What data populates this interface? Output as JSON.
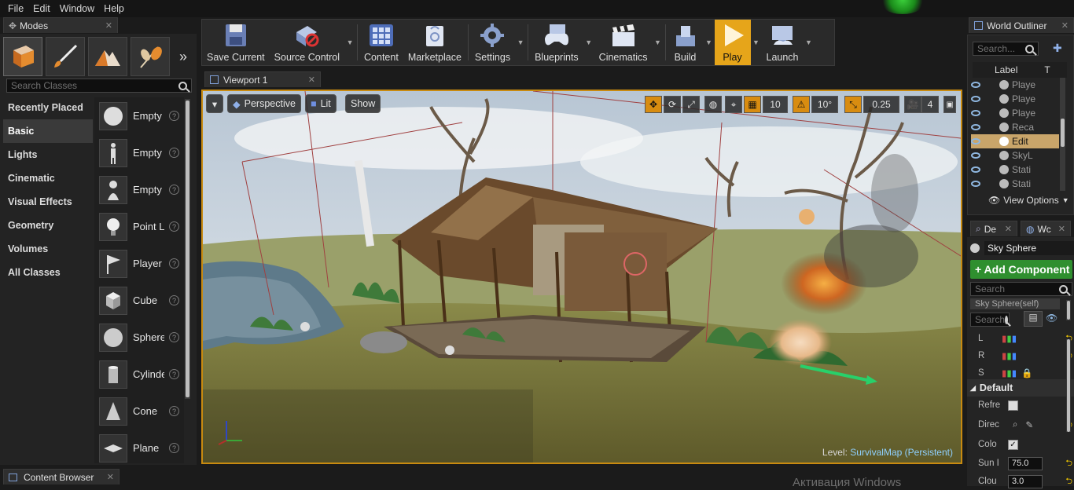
{
  "menubar": {
    "items": [
      "File",
      "Edit",
      "Window",
      "Help"
    ]
  },
  "modes": {
    "tab_label": "Modes",
    "search_placeholder": "Search Classes",
    "categories": [
      "Recently Placed",
      "Basic",
      "Lights",
      "Cinematic",
      "Visual Effects",
      "Geometry",
      "Volumes",
      "All Classes"
    ],
    "active_category": "Basic",
    "items": [
      "Empty",
      "Empty",
      "Empty",
      "Point L",
      "Player",
      "Cube",
      "Sphere",
      "Cylinde",
      "Cone",
      "Plane"
    ]
  },
  "toolbar": {
    "buttons": [
      "Save Current",
      "Source Control",
      "Content",
      "Marketplace",
      "Settings",
      "Blueprints",
      "Cinematics",
      "Build",
      "Play",
      "Launch"
    ]
  },
  "viewport": {
    "tab_label": "Viewport 1",
    "perspective": "Perspective",
    "lit": "Lit",
    "show": "Show",
    "grid_snap": "10",
    "rot_snap": "10°",
    "scale_snap": "0.25",
    "cam_speed": "4",
    "level_prefix": "Level:",
    "level_name": "SurvivalMap (Persistent)"
  },
  "outliner": {
    "tab_label": "World Outliner",
    "search_placeholder": "Search...",
    "col_label": "Label",
    "col_type": "T",
    "rows": [
      "Playe",
      "Playe",
      "Playe",
      "Reca",
      "Edit",
      "SkyL",
      "Stati",
      "Stati"
    ],
    "selected_index": 4,
    "view_options": "View Options"
  },
  "details": {
    "tab_de": "De",
    "tab_wc": "Wc",
    "actor_name": "Sky Sphere",
    "add_component": "+ Add Component",
    "search_placeholder": "Search",
    "component_row": "Sky Sphere(self)",
    "search2_placeholder": "Search",
    "transform_labels": [
      "L",
      "R",
      "S"
    ],
    "section": "Default",
    "props": [
      {
        "label": "Refre",
        "type": "checkbox",
        "checked": false
      },
      {
        "label": "Direc",
        "type": "picker"
      },
      {
        "label": "Colo",
        "type": "checkbox",
        "checked": true
      },
      {
        "label": "Sun I",
        "type": "number",
        "value": "75.0"
      },
      {
        "label": "Clou",
        "type": "number",
        "value": "3.0"
      }
    ]
  },
  "bottom": {
    "content_browser": "Content Browser",
    "watermark": "Активация Windows"
  },
  "colors": {
    "accent_orange": "#e6a51a",
    "selection": "#c9a56a",
    "add_green": "#2f8f2f"
  }
}
